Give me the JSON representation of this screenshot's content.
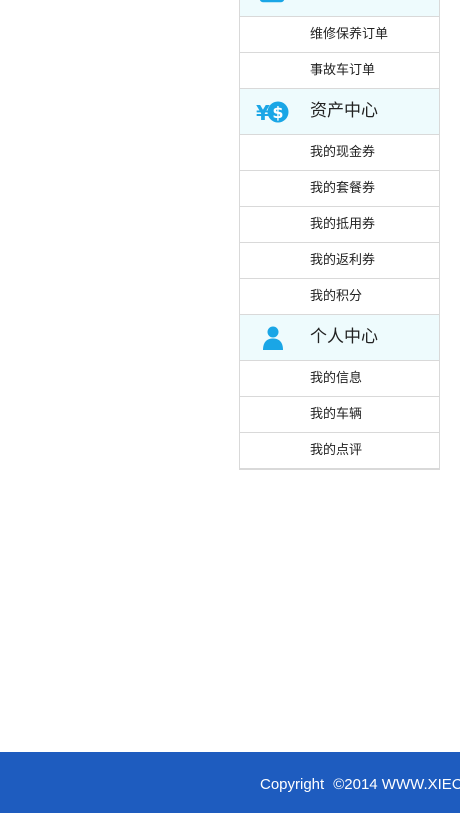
{
  "colors": {
    "section_bg": "#eefbfd",
    "icon_blue": "#1aa6e6",
    "footer_bg": "#1e5cbf",
    "border": "#d9d9d9"
  },
  "sidebar": {
    "sections": [
      {
        "icon": "order-list-icon",
        "title": "",
        "items": [
          {
            "label": "维修保养订单"
          },
          {
            "label": "事故车订单"
          }
        ]
      },
      {
        "icon": "currency-yen-dollar-icon",
        "title": "资产中心",
        "items": [
          {
            "label": "我的现金券"
          },
          {
            "label": "我的套餐券"
          },
          {
            "label": "我的抵用券"
          },
          {
            "label": "我的返利券"
          },
          {
            "label": "我的积分"
          }
        ]
      },
      {
        "icon": "user-icon",
        "title": "个人中心",
        "items": [
          {
            "label": "我的信息"
          },
          {
            "label": "我的车辆"
          },
          {
            "label": "我的点评"
          }
        ]
      }
    ]
  },
  "footer": {
    "copyright_label": "Copyright",
    "copyright_text": "©2014 WWW.XIEC"
  }
}
